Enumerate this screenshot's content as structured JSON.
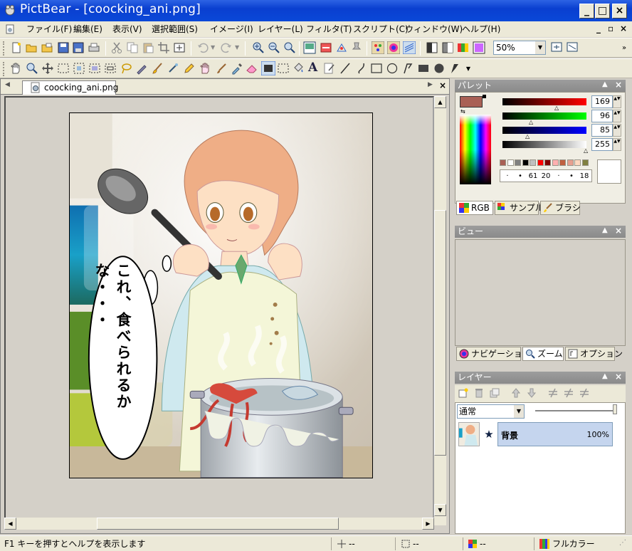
{
  "window": {
    "title": "PictBear - [coocking_ani.png]",
    "controls": {
      "minimize": "_",
      "maximize": "□",
      "close": "×"
    },
    "mdi_controls": {
      "minimize": "_",
      "restore": "▫",
      "close": "×"
    }
  },
  "menu": [
    "ファイル(F)",
    "編集(E)",
    "表示(V)",
    "選択範囲(S)",
    "イメージ(I)",
    "レイヤー(L)",
    "フィルタ(T)",
    "スクリプト(C)",
    "ウィンドウ(W)",
    "ヘルプ(H)"
  ],
  "toolbar": {
    "zoom": "50%"
  },
  "document": {
    "tab_label": "coocking_ani.png",
    "speech_text": "これ、食べられるかな・・・"
  },
  "palette": {
    "title": "パレット",
    "r": "169",
    "g": "96",
    "b": "85",
    "a": "255",
    "current_color": "#a96055",
    "brush_sizes": [
      "·",
      "•",
      "61",
      "20",
      "·",
      "•",
      "18"
    ],
    "tabs": [
      "RGB",
      "サンプル",
      "ブラシ"
    ],
    "swatches": [
      "#a96055",
      "#ffffff",
      "#808080",
      "#000000",
      "#c0c0c0",
      "#ff0000",
      "#800000",
      "#ffb0b0",
      "#c06040",
      "#e8a090",
      "#ffd8c0",
      "#808040"
    ]
  },
  "view": {
    "title": "ビュー",
    "tabs": [
      "ナビゲーション",
      "ズーム",
      "オプション"
    ]
  },
  "layers": {
    "title": "レイヤー",
    "blend_mode": "通常",
    "items": [
      {
        "name": "背景",
        "opacity": "100%"
      }
    ]
  },
  "status": {
    "help": "F1 キーを押すとヘルプを表示します",
    "pos": "--",
    "size": "--",
    "color": "--",
    "mode": "フルカラー"
  }
}
